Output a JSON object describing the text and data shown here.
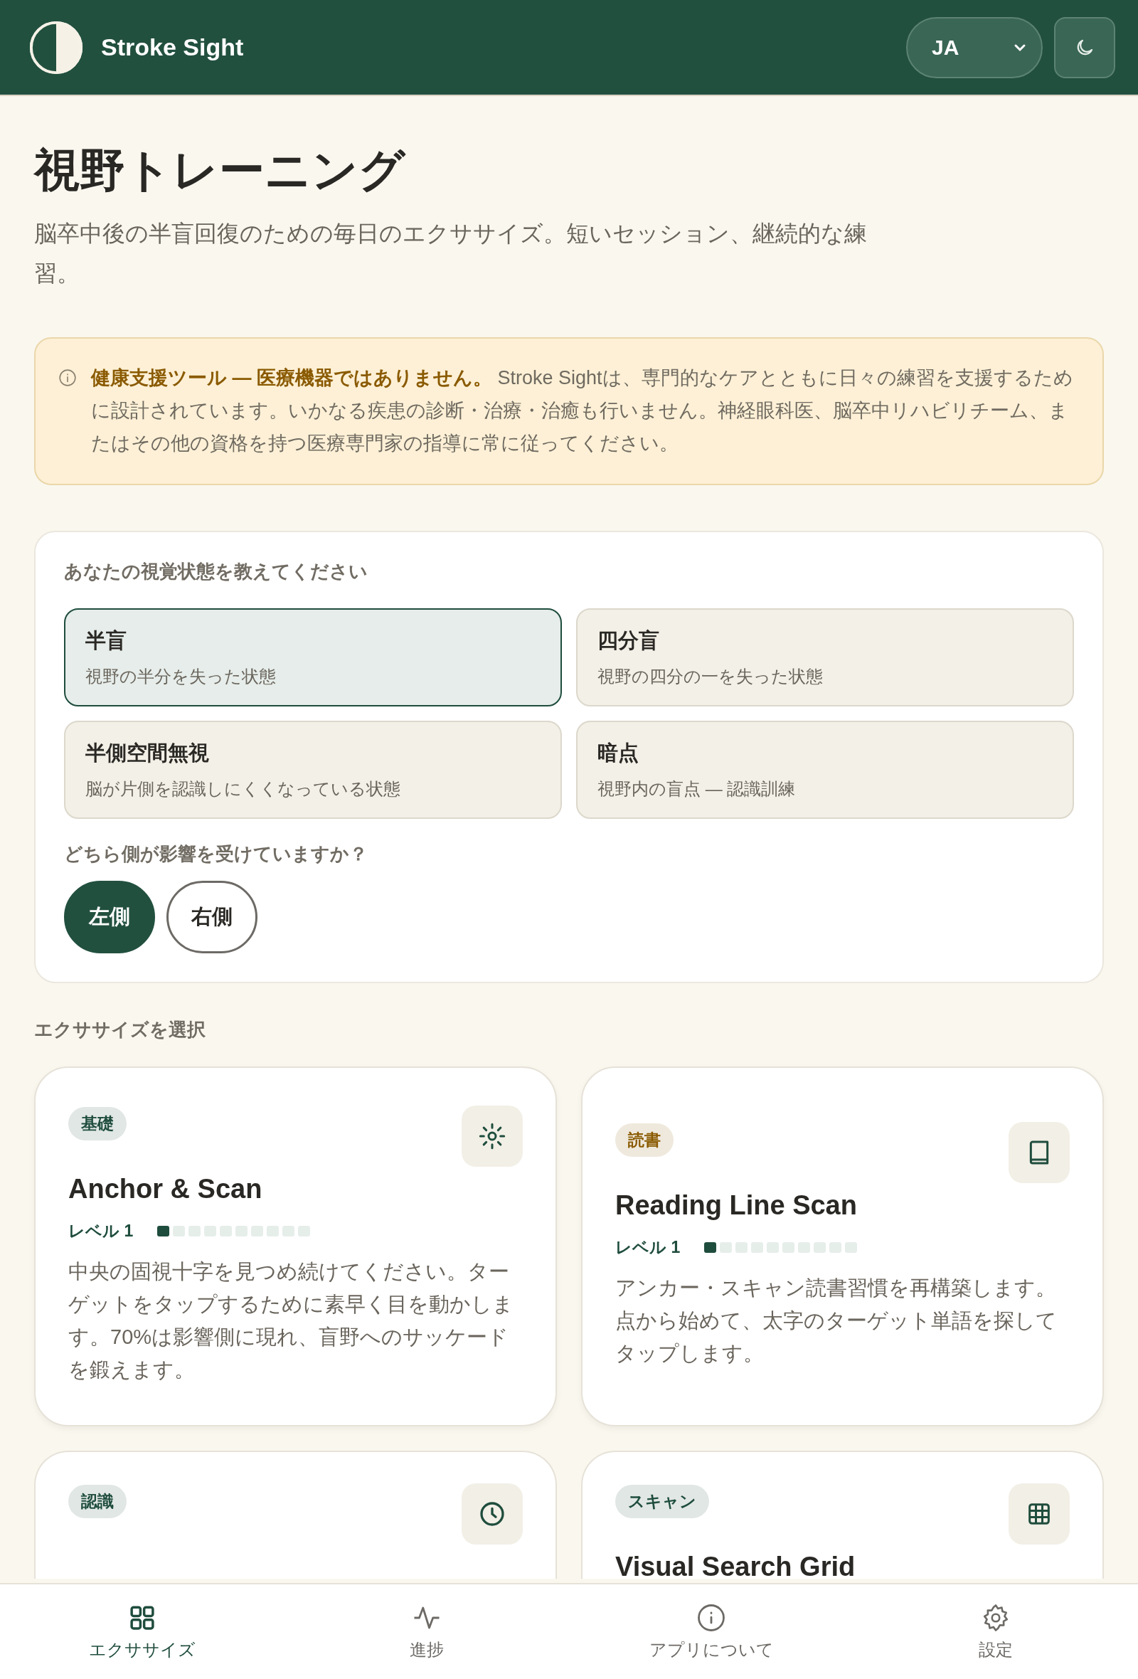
{
  "header": {
    "app_name": "Stroke Sight",
    "language": "JA"
  },
  "page": {
    "title": "視野トレーニング",
    "subtitle": "脳卒中後の半盲回復のための毎日のエクササイズ。短いセッション、継続的な練習。"
  },
  "disclaimer": {
    "text": "**健康支援ツール — 医療機器ではありません。** Stroke Sightは、専門的なケアとともに日々の練習を支援するために設計されています。いかなる疾患の診断・治療・治癒も行いません。神経眼科医、脳卒中リハビリチーム、またはその他の資格を持つ医療専門家の指導に常に従ってください。"
  },
  "condition": {
    "heading": "あなたの視覚状態を教えてください",
    "options": [
      {
        "title": "半盲",
        "description": "視野の半分を失った状態",
        "selected": true
      },
      {
        "title": "四分盲",
        "description": "視野の四分の一を失った状態",
        "selected": false
      },
      {
        "title": "半側空間無視",
        "description": "脳が片側を認識しにくくなっている状態",
        "selected": false
      },
      {
        "title": "暗点",
        "description": "視野内の盲点 — 認識訓練",
        "selected": false
      }
    ],
    "side_question": "どちら側が影響を受けていますか？",
    "sides": [
      {
        "label": "左側",
        "selected": true
      },
      {
        "label": "右側",
        "selected": false
      }
    ]
  },
  "exercises": {
    "heading": "エクササイズを選択",
    "cards": [
      {
        "tag": "基礎",
        "color": "#1f4d3d",
        "title": "Anchor & Scan",
        "level_label": "レベル 1",
        "level": 0.1,
        "description": "中央の固視十字を見つめ続けてください。ターゲットをタップするために素早く目を動かします。70%は影響側に現れ、盲野へのサッケードを鍛えます。"
      },
      {
        "tag": "読書",
        "color": "#8a5a00",
        "title": "Reading Line Scan",
        "level_label": "レベル 1",
        "level": 0.1,
        "description": "アンカー・スキャン読書習慣を再構築します。点から始めて、太字のターゲット単語を探してタップします。"
      },
      {
        "tag": "認識",
        "color": "#1f4d3d"
      },
      {
        "tag": "スキャン",
        "color": "#1f4d3d",
        "title": "Visual Search Grid"
      }
    ]
  },
  "bottom_nav": [
    {
      "label": "エクササイズ",
      "selected": true
    },
    {
      "label": "進捗",
      "selected": false
    },
    {
      "label": "アプリについて",
      "selected": false
    },
    {
      "label": "設定",
      "selected": false
    }
  ]
}
